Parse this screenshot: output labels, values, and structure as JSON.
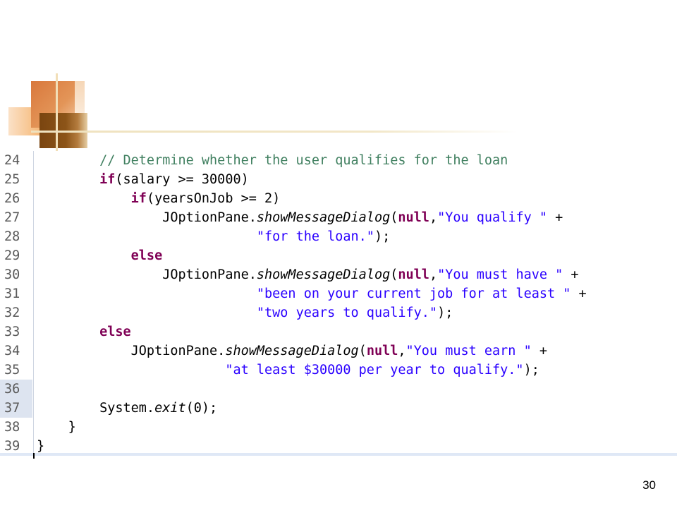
{
  "slide": {
    "page_number": "30"
  },
  "code": {
    "lines": [
      {
        "num": "24",
        "indent": "        ",
        "tokens": [
          {
            "t": "// Determine whether the user qualifies for the loan",
            "k": "cm"
          }
        ]
      },
      {
        "num": "25",
        "indent": "        ",
        "tokens": [
          {
            "t": "if",
            "k": "kw"
          },
          {
            "t": "(salary >= 30000)",
            "k": "pl"
          }
        ]
      },
      {
        "num": "26",
        "indent": "            ",
        "tokens": [
          {
            "t": "if",
            "k": "kw"
          },
          {
            "t": "(yearsOnJob >= 2)",
            "k": "pl"
          }
        ]
      },
      {
        "num": "27",
        "indent": "                ",
        "tokens": [
          {
            "t": "JOptionPane.",
            "k": "pl"
          },
          {
            "t": "showMessageDialog",
            "k": "it"
          },
          {
            "t": "(",
            "k": "pl"
          },
          {
            "t": "null",
            "k": "kw"
          },
          {
            "t": ",",
            "k": "pl"
          },
          {
            "t": "\"You qualify \"",
            "k": "str"
          },
          {
            "t": " +",
            "k": "pl"
          }
        ]
      },
      {
        "num": "28",
        "indent": "                            ",
        "tokens": [
          {
            "t": "\"for the loan.\"",
            "k": "str"
          },
          {
            "t": ");",
            "k": "pl"
          }
        ]
      },
      {
        "num": "29",
        "indent": "            ",
        "tokens": [
          {
            "t": "else",
            "k": "kw"
          }
        ]
      },
      {
        "num": "30",
        "indent": "                ",
        "tokens": [
          {
            "t": "JOptionPane.",
            "k": "pl"
          },
          {
            "t": "showMessageDialog",
            "k": "it"
          },
          {
            "t": "(",
            "k": "pl"
          },
          {
            "t": "null",
            "k": "kw"
          },
          {
            "t": ",",
            "k": "pl"
          },
          {
            "t": "\"You must have \"",
            "k": "str"
          },
          {
            "t": " +",
            "k": "pl"
          }
        ]
      },
      {
        "num": "31",
        "indent": "                            ",
        "tokens": [
          {
            "t": "\"been on your current job for at least \"",
            "k": "str"
          },
          {
            "t": " +",
            "k": "pl"
          }
        ]
      },
      {
        "num": "32",
        "indent": "                            ",
        "tokens": [
          {
            "t": "\"two years to qualify.\"",
            "k": "str"
          },
          {
            "t": ");",
            "k": "pl"
          }
        ]
      },
      {
        "num": "33",
        "indent": "        ",
        "tokens": [
          {
            "t": "else",
            "k": "kw"
          }
        ]
      },
      {
        "num": "34",
        "indent": "            ",
        "tokens": [
          {
            "t": "JOptionPane.",
            "k": "pl"
          },
          {
            "t": "showMessageDialog",
            "k": "it"
          },
          {
            "t": "(",
            "k": "pl"
          },
          {
            "t": "null",
            "k": "kw"
          },
          {
            "t": ",",
            "k": "pl"
          },
          {
            "t": "\"You must earn \"",
            "k": "str"
          },
          {
            "t": " +",
            "k": "pl"
          }
        ]
      },
      {
        "num": "35",
        "indent": "                        ",
        "tokens": [
          {
            "t": "\"at least $30000 per year to qualify.\"",
            "k": "str"
          },
          {
            "t": ");",
            "k": "pl"
          }
        ]
      },
      {
        "num": "36",
        "indent": "",
        "highlighted": true,
        "tokens": []
      },
      {
        "num": "37",
        "indent": "        ",
        "highlighted": true,
        "tokens": [
          {
            "t": "System.",
            "k": "pl"
          },
          {
            "t": "exit",
            "k": "it"
          },
          {
            "t": "(0);",
            "k": "pl"
          }
        ]
      },
      {
        "num": "38",
        "indent": "    ",
        "tokens": [
          {
            "t": "}",
            "k": "pl"
          }
        ]
      },
      {
        "num": "39",
        "indent": "",
        "tokens": [
          {
            "t": "}",
            "k": "pl"
          }
        ]
      }
    ]
  },
  "colors": {
    "keyword": "#7f0055",
    "string": "#2a00ff",
    "comment": "#3f7f5f",
    "plain": "#000000",
    "line_number": "#5a5a5a"
  }
}
